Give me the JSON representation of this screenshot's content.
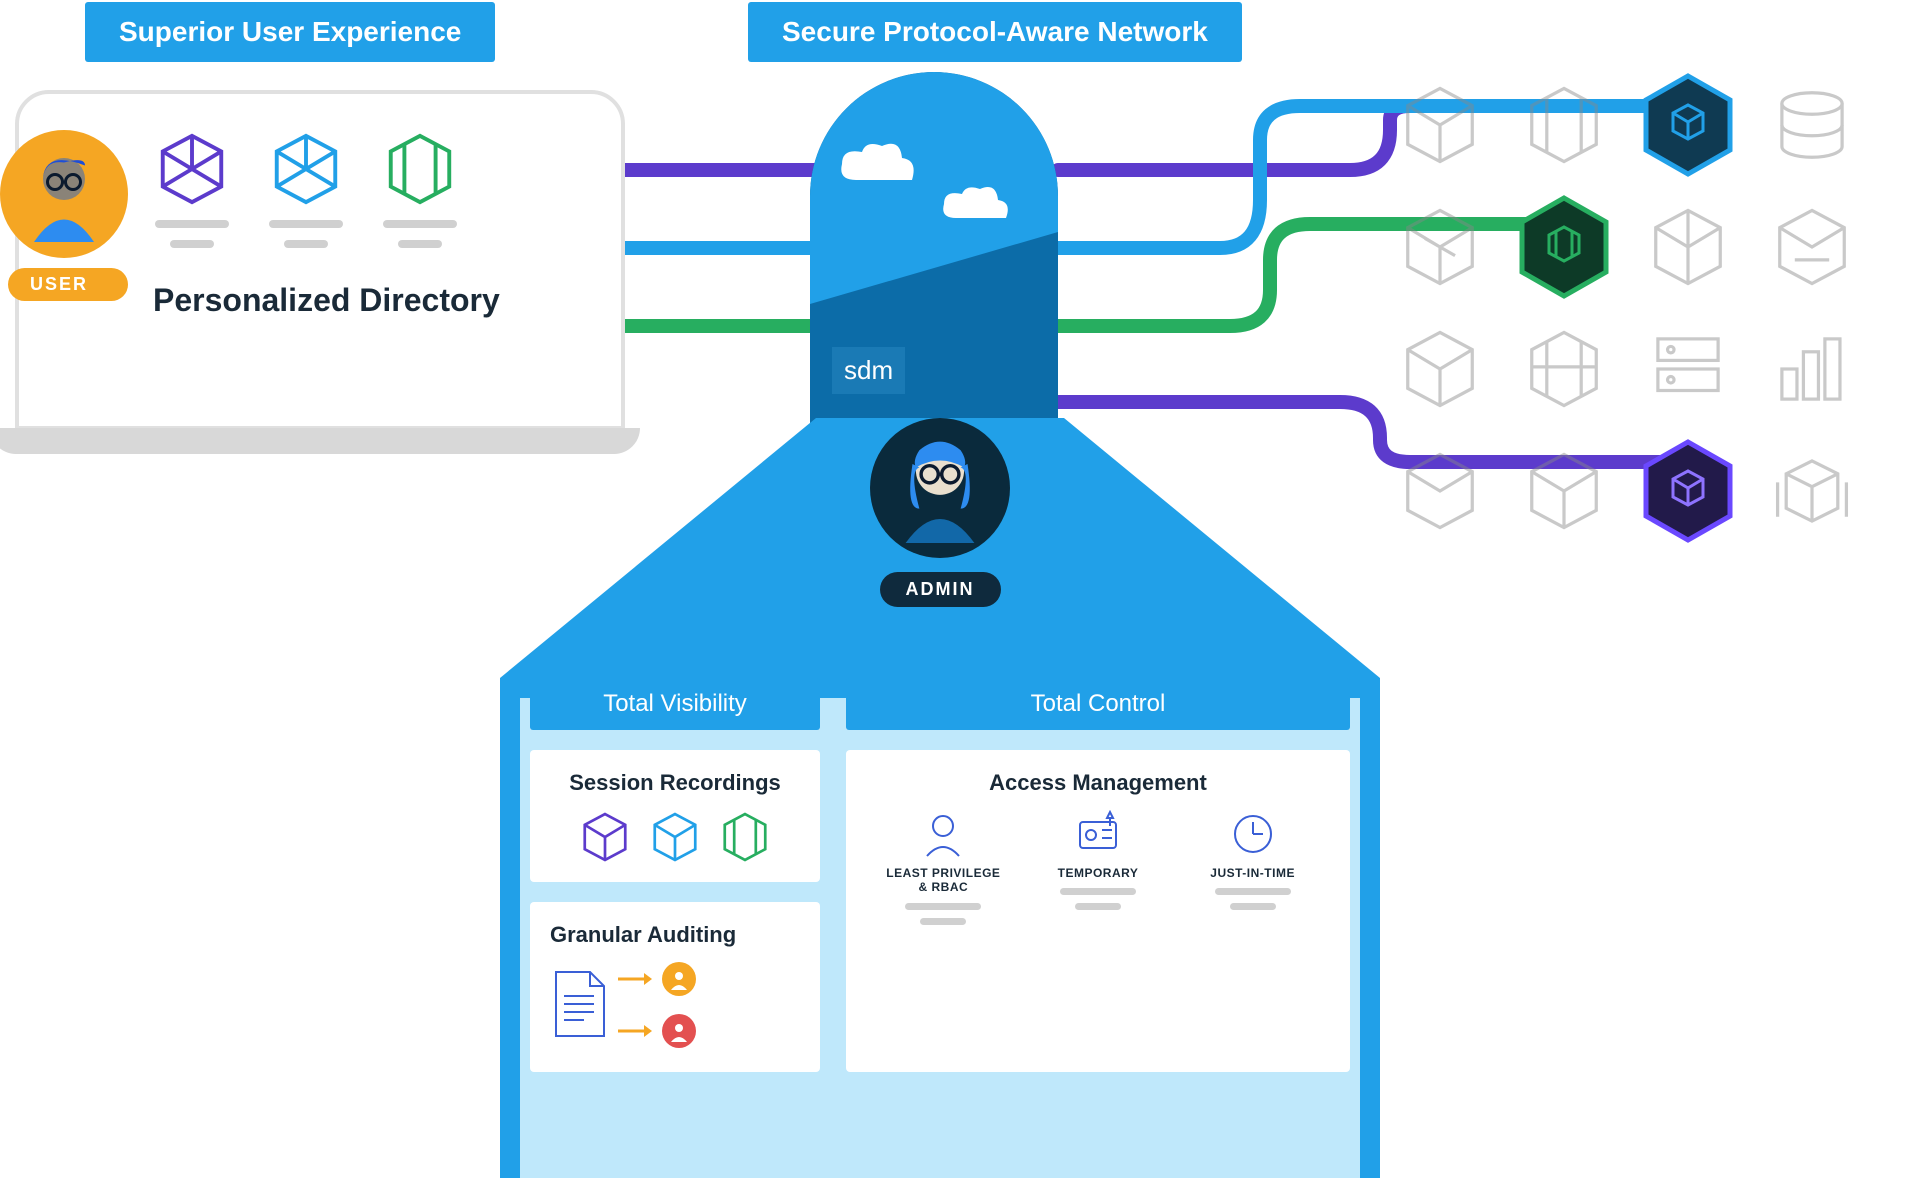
{
  "headers": {
    "left": "Superior User Experience",
    "right": "Secure Protocol-Aware Network"
  },
  "user": {
    "badge": "USER",
    "directory_title": "Personalized Directory"
  },
  "arch": {
    "brand": "sdm"
  },
  "admin": {
    "badge": "ADMIN"
  },
  "panel": {
    "visibility_title": "Total Visibility",
    "control_title": "Total Control",
    "session_title": "Session Recordings",
    "auditing_title": "Granular Auditing",
    "access_title": "Access Management",
    "access_items": [
      "LEAST PRIVILEGE & RBAC",
      "TEMPORARY",
      "JUST-IN-TIME"
    ]
  },
  "wires": {
    "colors": {
      "purple": "#5c3bcc",
      "blue": "#21a0e8",
      "green": "#27ae60"
    }
  },
  "resources": {
    "highlighted": [
      {
        "row": 0,
        "col": 2,
        "color": "#21a0e8"
      },
      {
        "row": 1,
        "col": 1,
        "color": "#27ae60"
      },
      {
        "row": 3,
        "col": 2,
        "color": "#5c3bcc"
      }
    ]
  }
}
